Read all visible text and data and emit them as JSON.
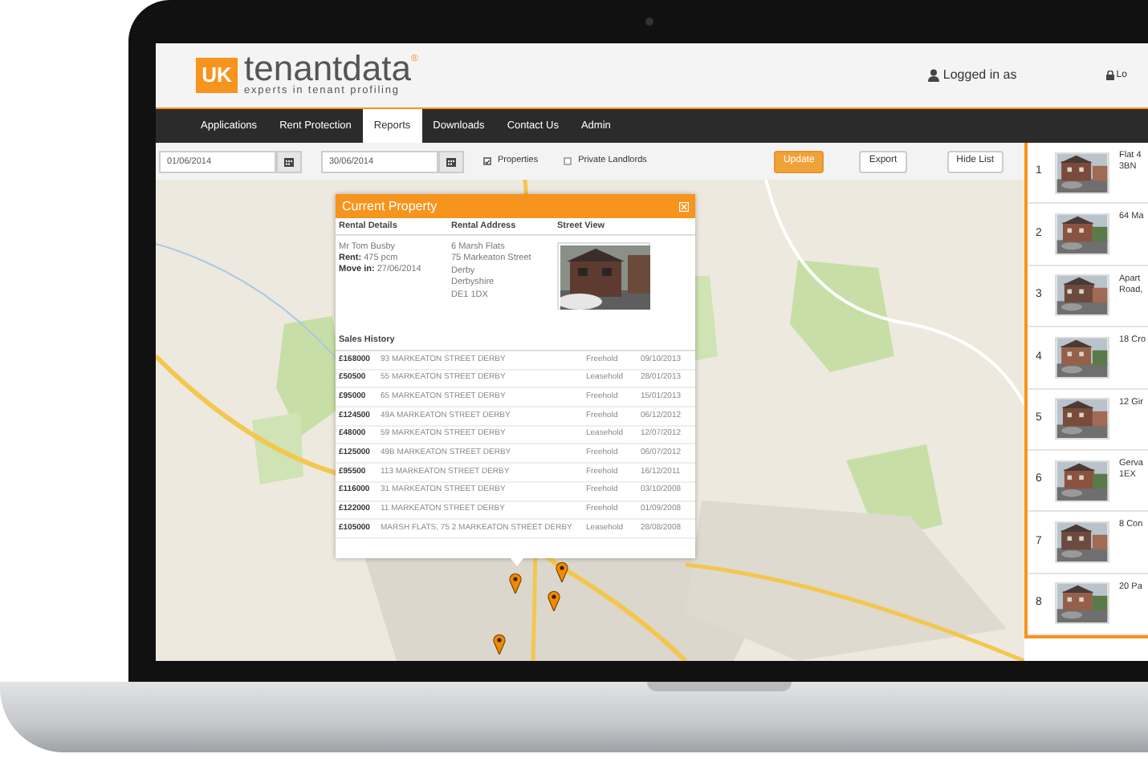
{
  "header": {
    "logo": {
      "badge": "UK",
      "name": "tenantdata",
      "mark": "®",
      "tagline": "experts in tenant profiling"
    },
    "user": "Logged in as",
    "logout": "Lo"
  },
  "nav": [
    {
      "label": "Applications",
      "selected": false
    },
    {
      "label": "Rent Protection",
      "selected": false
    },
    {
      "label": "Reports",
      "selected": true
    },
    {
      "label": "Downloads",
      "selected": false
    },
    {
      "label": "Contact Us",
      "selected": false
    },
    {
      "label": "Admin",
      "selected": false
    }
  ],
  "toolbar": {
    "date_from": "01/06/2014",
    "date_to": "30/06/2014",
    "filters": [
      {
        "label": "Properties",
        "checked": true
      },
      {
        "label": "Private Landlords",
        "checked": false
      }
    ],
    "buttons": [
      {
        "label": "Update",
        "kind": "primary"
      },
      {
        "label": "Export",
        "kind": "default"
      },
      {
        "label": "Hide List",
        "kind": "default"
      }
    ]
  },
  "popup": {
    "title": "Current Property",
    "columns": [
      "Rental Details",
      "Rental Address",
      "Street View"
    ],
    "tenant": "Mr Tom Busby",
    "details": [
      "**Rent:** 475 pcm",
      "**Move in:** 27/06/2014"
    ],
    "address": [
      "6 Marsh Flats",
      "75 Markeaton Street",
      "Derby",
      "Derbyshire",
      "DE1 1DX"
    ],
    "sales_title": "Sales History",
    "sales": [
      {
        "price": "£168000",
        "address": "93 MARKEATON STREET DERBY",
        "tenure": "Freehold",
        "date": "09/10/2013"
      },
      {
        "price": "£50500",
        "address": "55 MARKEATON STREET DERBY",
        "tenure": "Leasehold",
        "date": "28/01/2013"
      },
      {
        "price": "£95000",
        "address": "65 MARKEATON STREET DERBY",
        "tenure": "Freehold",
        "date": "15/01/2013"
      },
      {
        "price": "£124500",
        "address": "49A MARKEATON STREET DERBY",
        "tenure": "Freehold",
        "date": "06/12/2012"
      },
      {
        "price": "£48000",
        "address": "59 MARKEATON STREET DERBY",
        "tenure": "Leasehold",
        "date": "12/07/2012"
      },
      {
        "price": "£125000",
        "address": "49B MARKEATON STREET DERBY",
        "tenure": "Freehold",
        "date": "06/07/2012"
      },
      {
        "price": "£95500",
        "address": "113 MARKEATON STREET DERBY",
        "tenure": "Freehold",
        "date": "16/12/2011"
      },
      {
        "price": "£116000",
        "address": "31 MARKEATON STREET DERBY",
        "tenure": "Freehold",
        "date": "03/10/2008"
      },
      {
        "price": "£122000",
        "address": "11 MARKEATON STREET DERBY",
        "tenure": "Freehold",
        "date": "01/09/2008"
      },
      {
        "price": "£105000",
        "address": "MARSH FLATS, 75 2 MARKEATON STREET DERBY",
        "tenure": "Leasehold",
        "date": "28/08/2008"
      }
    ]
  },
  "list": [
    {
      "number": "1",
      "lines": [
        "Flat 4",
        "3BN"
      ]
    },
    {
      "number": "2",
      "lines": [
        "64 Ma"
      ]
    },
    {
      "number": "3",
      "lines": [
        "Apart",
        "Road,"
      ]
    },
    {
      "number": "4",
      "lines": [
        "18 Cro"
      ]
    },
    {
      "number": "5",
      "lines": [
        "12 Gir"
      ]
    },
    {
      "number": "6",
      "lines": [
        "Gerva",
        "1EX"
      ]
    },
    {
      "number": "7",
      "lines": [
        "8 Con"
      ]
    },
    {
      "number": "8",
      "lines": [
        "20 Pa"
      ]
    }
  ]
}
